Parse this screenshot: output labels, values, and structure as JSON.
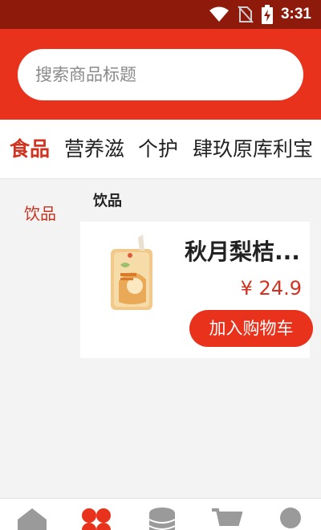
{
  "status_bar": {
    "time": "3:31",
    "icons": [
      "wifi-icon",
      "no-sim-icon",
      "battery-charging-icon"
    ]
  },
  "search": {
    "placeholder": "搜索商品标题"
  },
  "tabs": [
    {
      "label": "食品",
      "active": true
    },
    {
      "label": "营养滋",
      "active": false
    },
    {
      "label": "个护",
      "active": false
    },
    {
      "label": "肆玖原库利宝",
      "active": false
    }
  ],
  "sidebar": {
    "items": [
      {
        "label": "饮品",
        "active": true
      }
    ]
  },
  "main": {
    "section_title": "饮品",
    "products": [
      {
        "name": "秋月梨桔...",
        "price": "¥ 24.9",
        "button_label": "加入购物车",
        "image_icon": "juice-package-icon"
      }
    ]
  },
  "bottom_nav": {
    "items": [
      {
        "icon": "home-icon",
        "active": false
      },
      {
        "icon": "category-icon",
        "active": true
      },
      {
        "icon": "coins-icon",
        "active": false
      },
      {
        "icon": "cart-icon",
        "active": false
      },
      {
        "icon": "profile-icon",
        "active": false
      }
    ]
  },
  "colors": {
    "status_bar": "#8e1a0b",
    "header": "#e8321b",
    "accent": "#d2321f",
    "inactive_icon": "#9a9a9a"
  }
}
